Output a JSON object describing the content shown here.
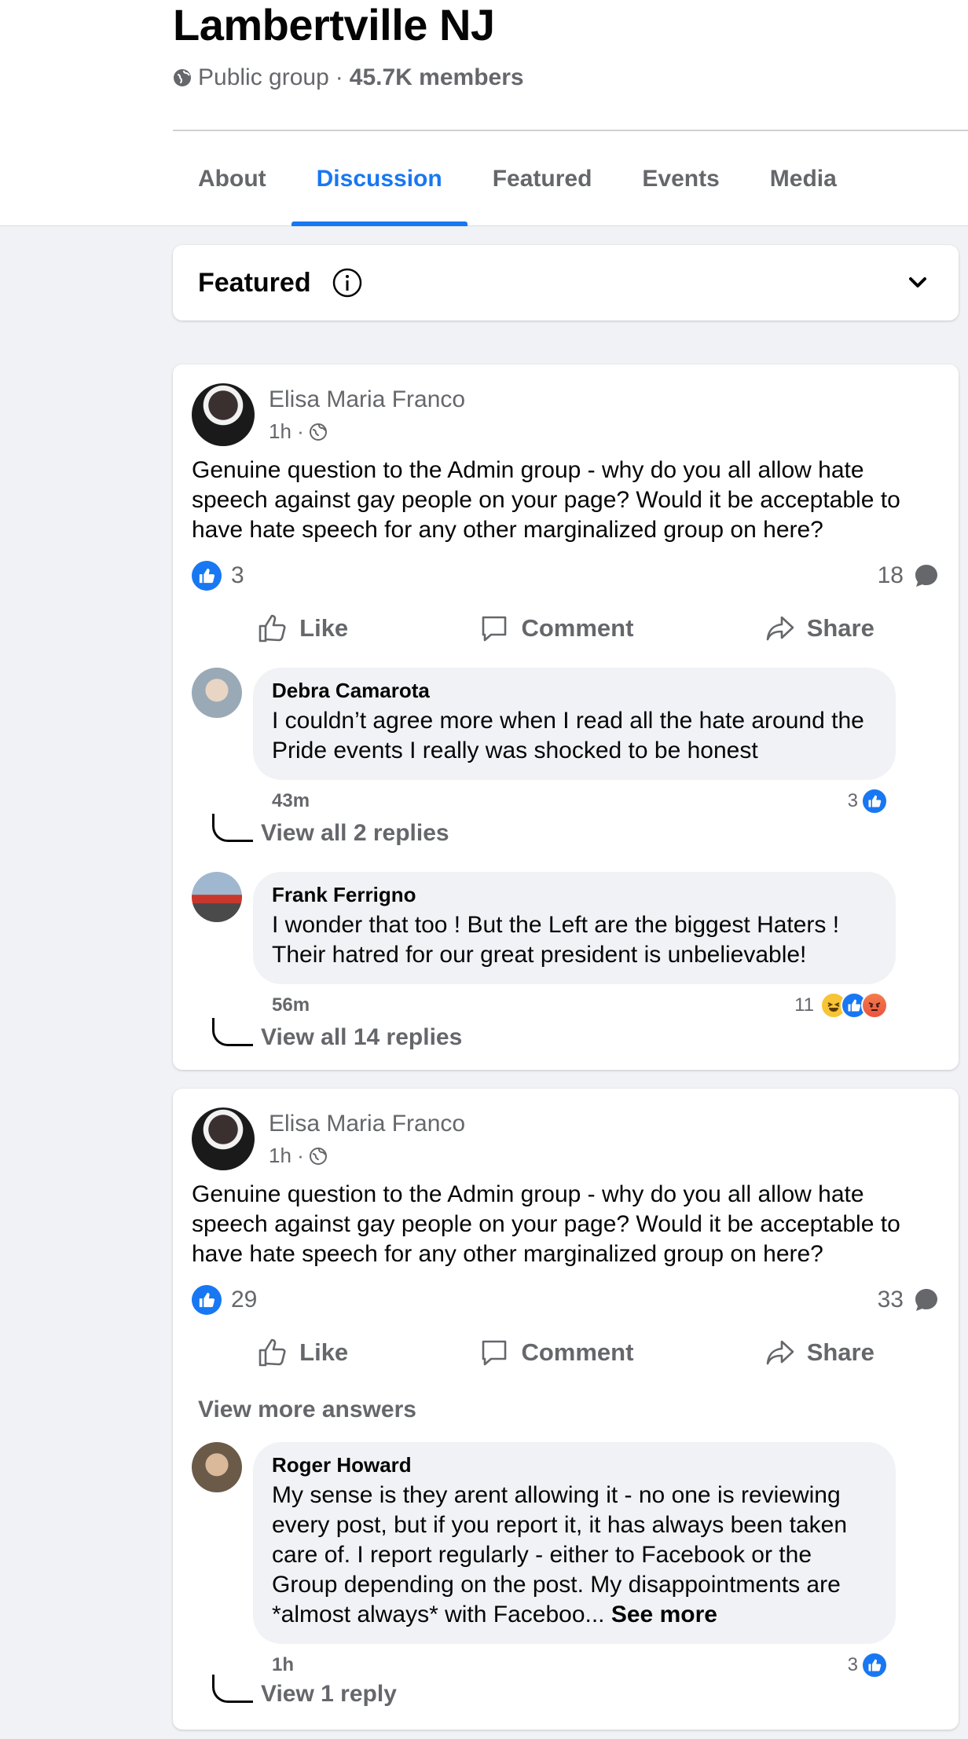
{
  "group": {
    "name": "Lambertville NJ",
    "privacy": "Public group",
    "separator": "·",
    "members": "45.7K members"
  },
  "tabs": [
    "About",
    "Discussion",
    "Featured",
    "Events",
    "Media"
  ],
  "featured_bar": {
    "label": "Featured"
  },
  "actions": {
    "like": "Like",
    "comment": "Comment",
    "share": "Share"
  },
  "posts": [
    {
      "author": "Elisa Maria Franco",
      "time": "1h ·",
      "text": "Genuine question to the Admin group - why do you all allow hate speech against gay people on your page? Would it be acceptable to have hate speech for any other marginalized group on here?",
      "likes": "3",
      "comments": "18",
      "comment_items": [
        {
          "name": "Debra Camarota",
          "text": "I couldn’t agree more when I read all the hate around the Pride events I really was shocked to be honest",
          "time": "43m",
          "reactions": "3",
          "replies": "View all 2 replies"
        },
        {
          "name": "Frank Ferrigno",
          "text": "I wonder that too ! But the Left are the biggest Haters ! Their hatred for our great president is unbelievable!",
          "time": "56m",
          "reactions": "11",
          "replies": "View all 14 replies"
        }
      ]
    },
    {
      "author": "Elisa Maria Franco",
      "time": "1h ·",
      "text": "Genuine question to the Admin group - why do you all allow hate speech against gay people on your page? Would it be acceptable to have hate speech for any other marginalized group on here?",
      "likes": "29",
      "comments": "33",
      "view_more": "View more answers",
      "comment_items": [
        {
          "name": "Roger Howard",
          "text": "My sense is they arent allowing it - no one is reviewing every post, but if you report it, it has always been taken care of. I report regularly - either to Facebook or the Group depending on the post. My disappointments are *almost always* with Faceboo...",
          "see_more": "See more",
          "time": "1h",
          "reactions": "3",
          "replies": "View 1 reply"
        }
      ]
    }
  ],
  "colors": {
    "accent": "#1877f2",
    "muted": "#65676b",
    "background": "#f0f2f5"
  }
}
